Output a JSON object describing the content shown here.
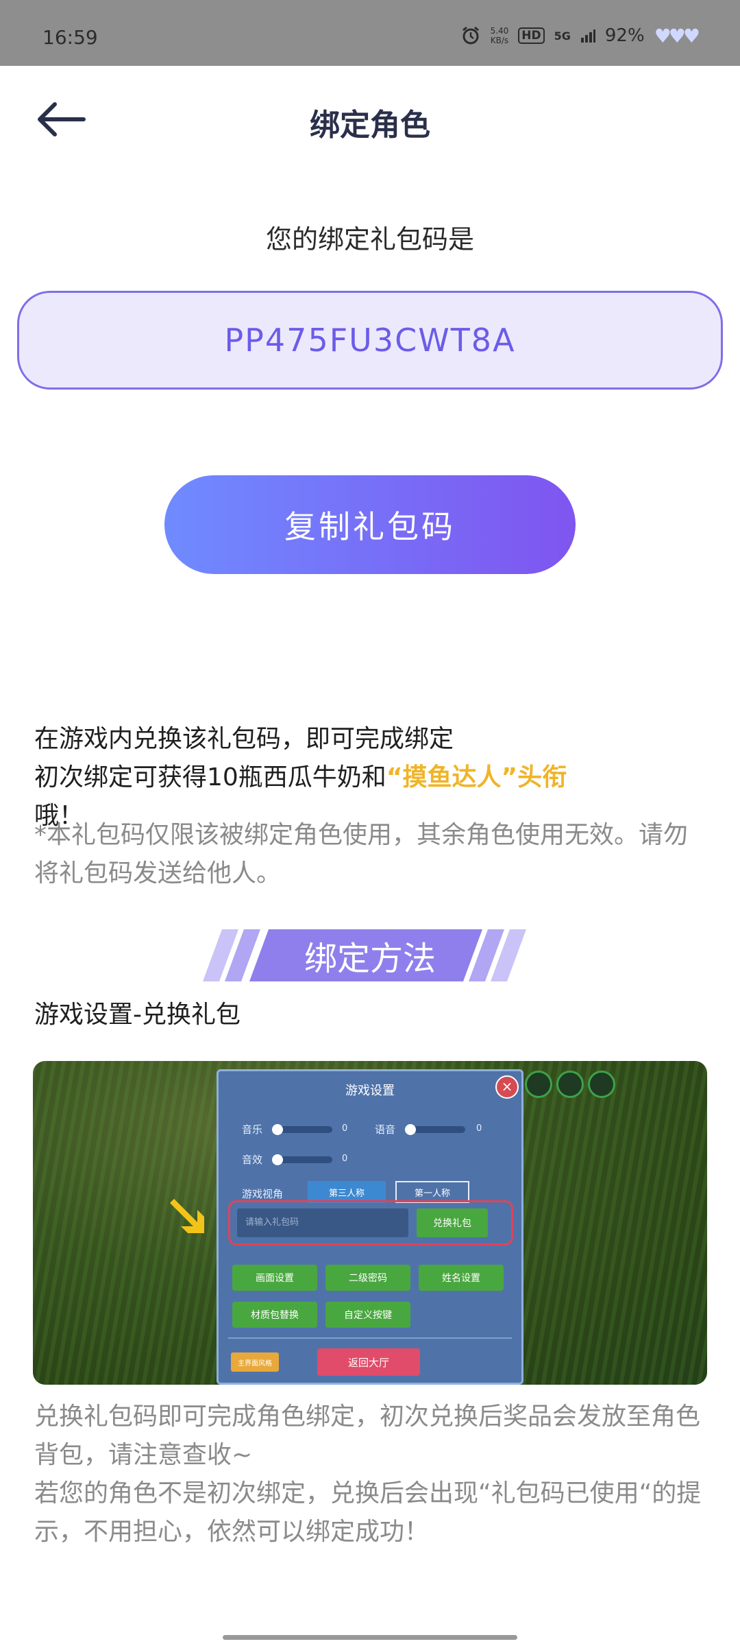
{
  "status": {
    "time": "16:59",
    "net_speed": "5.40\nKB/s",
    "hd": "HD",
    "signal": "5G",
    "battery": "92%"
  },
  "header": {
    "title": "绑定角色"
  },
  "code": {
    "label": "您的绑定礼包码是",
    "value": "PP475FU3CWT8A"
  },
  "copy_button": "复制礼包码",
  "info": {
    "line1": "在游戏内兑换该礼包码，即可完成绑定",
    "line2_prefix": "初次绑定可获得10瓶西瓜牛奶和",
    "line2_highlight": "“摸鱼达人”头衔",
    "line2_suffix": "哦！"
  },
  "note": "*本礼包码仅限该被绑定角色使用，其余角色使用无效。请勿将礼包码发送给他人。",
  "banner": "绑定方法",
  "method_path": "游戏设置-兑换礼包",
  "game": {
    "title": "游戏设置",
    "music": "音乐",
    "voice": "语音",
    "sfx": "音效",
    "zero": "0",
    "view_label": "游戏视角",
    "third_person": "第三人称",
    "first_person": "第一人称",
    "input_placeholder": "请输入礼包码",
    "redeem": "兑换礼包",
    "btn_picture": "画面设置",
    "btn_password": "二级密码",
    "btn_name": "姓名设置",
    "btn_texture": "材质包替换",
    "btn_keys": "自定义按键",
    "btn_style": "主界面风格",
    "btn_back": "返回大厅"
  },
  "desc": {
    "p1": "兑换礼包码即可完成角色绑定，初次兑换后奖品会发放至角色背包，请注意查收~",
    "p2": "若您的角色不是初次绑定，兑换后会出现“礼包码已使用“的提示，不用担心，依然可以绑定成功！"
  }
}
